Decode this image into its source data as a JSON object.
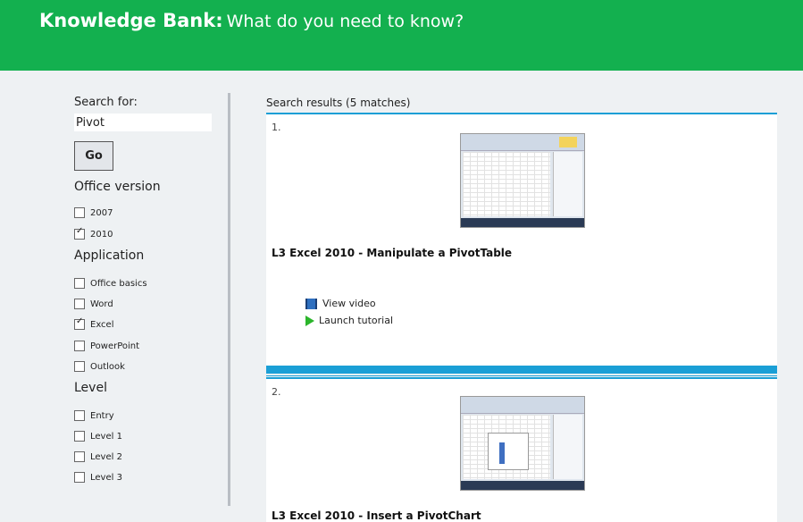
{
  "header": {
    "brand": "Knowledge Bank:",
    "tagline": "What do you need to know?"
  },
  "sidebar": {
    "search_label": "Search for:",
    "search_value": "Pivot",
    "go_label": "Go",
    "office_version": {
      "heading": "Office version",
      "options": [
        {
          "label": "2007",
          "checked": false
        },
        {
          "label": "2010",
          "checked": true
        }
      ]
    },
    "application": {
      "heading": "Application",
      "options": [
        {
          "label": "Office basics",
          "checked": false
        },
        {
          "label": "Word",
          "checked": false
        },
        {
          "label": "Excel",
          "checked": true
        },
        {
          "label": "PowerPoint",
          "checked": false
        },
        {
          "label": "Outlook",
          "checked": false
        }
      ]
    },
    "level": {
      "heading": "Level",
      "options": [
        {
          "label": "Entry",
          "checked": false
        },
        {
          "label": "Level 1",
          "checked": false
        },
        {
          "label": "Level 2",
          "checked": false
        },
        {
          "label": "Level 3",
          "checked": false
        }
      ]
    }
  },
  "results": {
    "title": "Search results (5 matches)",
    "items": [
      {
        "number": "1.",
        "title": "L3 Excel 2010 - Manipulate a PivotTable",
        "actions": [
          {
            "label": "View video",
            "icon": "video-icon"
          },
          {
            "label": "Launch tutorial",
            "icon": "play-icon"
          }
        ]
      },
      {
        "number": "2.",
        "title": "L3 Excel 2010 - Insert a PivotChart"
      }
    ]
  },
  "colors": {
    "header_green": "#13b04f",
    "accent_blue": "#1a9fd6",
    "play_green": "#2bb52b"
  }
}
